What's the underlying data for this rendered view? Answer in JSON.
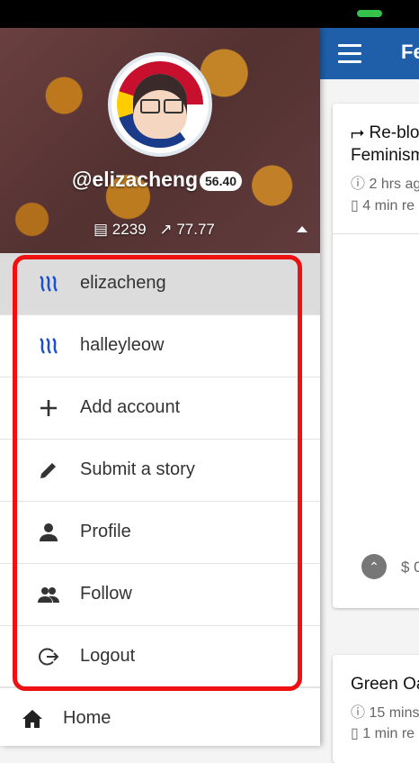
{
  "app": {
    "title_visible": "Fe",
    "cards": [
      {
        "reblog": "Re-blo",
        "title": "Feminism",
        "time": "2 hrs ag",
        "read": "4 min re",
        "payout": "$ 0"
      },
      {
        "title": "Green Oa",
        "time": "15 mins",
        "read": "1 min re"
      }
    ]
  },
  "drawer": {
    "username": "@elizacheng",
    "reputation": "56.40",
    "posts": "2239",
    "voting_power": "77.77",
    "menu": [
      {
        "label": "elizacheng",
        "icon": "steem-icon"
      },
      {
        "label": "halleyleow",
        "icon": "steem-icon"
      },
      {
        "label": "Add account",
        "icon": "plus-icon"
      },
      {
        "label": "Submit a story",
        "icon": "pencil-icon"
      },
      {
        "label": "Profile",
        "icon": "person-icon"
      },
      {
        "label": "Follow",
        "icon": "people-icon"
      },
      {
        "label": "Logout",
        "icon": "logout-icon"
      }
    ],
    "home_label": "Home"
  },
  "colors": {
    "appbar": "#1f5fa9",
    "highlight": "#ee1111",
    "steem": "#1a4fd0"
  }
}
